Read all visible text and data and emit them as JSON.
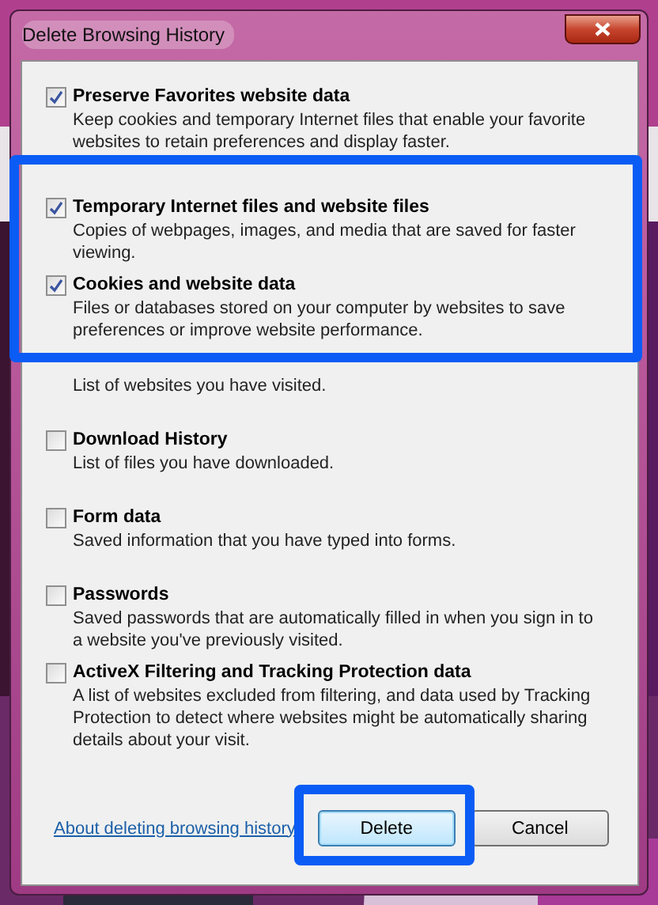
{
  "window": {
    "title": "Delete Browsing History"
  },
  "options": [
    {
      "label": "Preserve Favorites website data",
      "description": "Keep cookies and temporary Internet files that enable your favorite websites to retain preferences and display faster.",
      "checked": true
    },
    {
      "label": "Temporary Internet files and website files",
      "description": "Copies of webpages, images, and media that are saved for faster viewing.",
      "checked": true
    },
    {
      "label": "Cookies and website data",
      "description": "Files or databases stored on your computer by websites to save preferences or improve website performance.",
      "checked": true
    },
    {
      "description": "List of websites you have visited."
    },
    {
      "label": "Download History",
      "description": "List of files you have downloaded.",
      "checked": false
    },
    {
      "label": "Form data",
      "description": "Saved information that you have typed into forms.",
      "checked": false
    },
    {
      "label": "Passwords",
      "description": "Saved passwords that are automatically filled in when you sign in to a website you've previously visited.",
      "checked": false
    },
    {
      "label": "ActiveX Filtering and Tracking Protection data",
      "description": "A list of websites excluded from filtering, and data used by Tracking Protection to detect where websites might be automatically sharing details about your visit.",
      "checked": false
    }
  ],
  "footer": {
    "link": "About deleting browsing history",
    "buttons": [
      {
        "label": "Delete",
        "selected": true
      },
      {
        "label": "Cancel",
        "selected": false
      }
    ]
  }
}
